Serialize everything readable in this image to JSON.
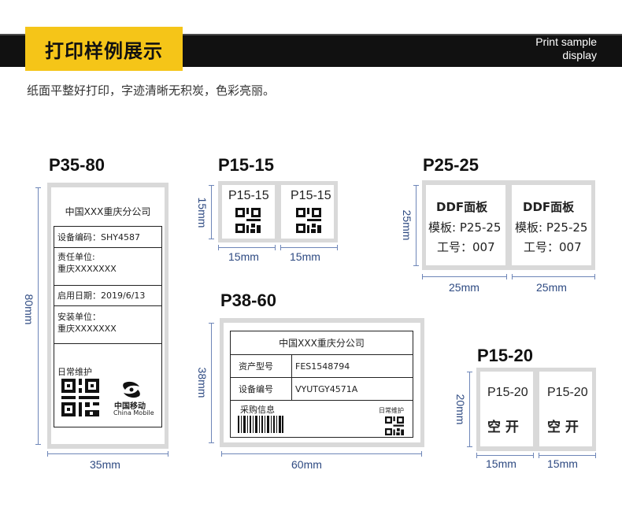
{
  "header": {
    "title": "打印样例展示",
    "en_line1": "Print sample",
    "en_line2": "display",
    "subtitle": "纸面平整好打印，字迹清晰无积炭，色彩亮丽。"
  },
  "colors": {
    "accent": "#f5c518",
    "band": "#111111",
    "dim": "#2e4a82"
  },
  "samples": {
    "p3580": {
      "model": "P35-80",
      "company": "中国XXX重庆分公司",
      "device_code": "设备编码：SHY4587",
      "responsible_label": "责任单位:",
      "responsible_value": "重庆XXXXXXX",
      "start_date": "启用日期：2019/6/13",
      "install_label": "安装单位：",
      "install_value": "重庆XXXXXXX",
      "maintenance": "日常维护",
      "brand_cn": "中国移动",
      "brand_en": "China Mobile",
      "width": "35mm",
      "height": "80mm"
    },
    "p1515": {
      "model": "P15-15",
      "label_text": "P15-15",
      "width": "15mm",
      "height": "15mm"
    },
    "p2525": {
      "model": "P25-25",
      "line1": "DDF面板",
      "line2": "模板: P25-25",
      "line3": "工号：007",
      "width": "25mm",
      "height": "25mm"
    },
    "p3860": {
      "model": "P38-60",
      "company": "中国XXX重庆分公司",
      "asset_label": "资产型号",
      "asset_value": "FES1548794",
      "device_label": "设备编号",
      "device_value": "VYUTGY4571A",
      "purchase": "采购信息",
      "maintenance": "日常维护",
      "width": "60mm",
      "height": "38mm"
    },
    "p1520": {
      "model": "P15-20",
      "label_text": "P15-20",
      "status": "空 开",
      "width": "15mm",
      "height": "20mm"
    }
  }
}
